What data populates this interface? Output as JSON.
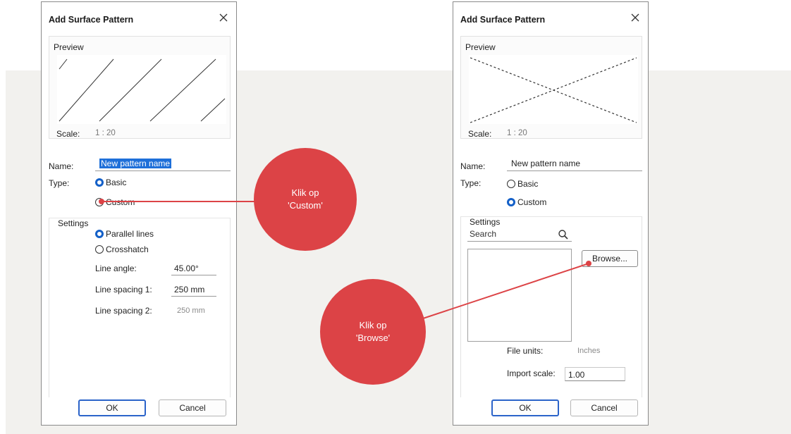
{
  "colors": {
    "accent": "#1460c8",
    "callout": "#dc4346",
    "background_band": "#f2f1ee"
  },
  "dialog_basic": {
    "title": "Add Surface Pattern",
    "close_icon": "close-icon",
    "preview_label": "Preview",
    "scale_label": "Scale:",
    "scale_value": "1 : 20",
    "name_label": "Name:",
    "name_value": "New pattern name",
    "type_label": "Type:",
    "type_options": [
      {
        "label": "Basic",
        "selected": true
      },
      {
        "label": "Custom",
        "selected": false
      }
    ],
    "settings_label": "Settings",
    "settings_options": [
      {
        "label": "Parallel lines",
        "selected": true
      },
      {
        "label": "Crosshatch",
        "selected": false
      }
    ],
    "line_angle_label": "Line angle:",
    "line_angle_value": "45.00°",
    "line_spacing1_label": "Line spacing 1:",
    "line_spacing1_value": "250 mm",
    "line_spacing2_label": "Line spacing 2:",
    "line_spacing2_value": "250 mm",
    "ok_label": "OK",
    "cancel_label": "Cancel"
  },
  "dialog_custom": {
    "title": "Add Surface Pattern",
    "close_icon": "close-icon",
    "preview_label": "Preview",
    "scale_label": "Scale:",
    "scale_value": "1 : 20",
    "name_label": "Name:",
    "name_value": "New pattern name",
    "type_label": "Type:",
    "type_options": [
      {
        "label": "Basic",
        "selected": false
      },
      {
        "label": "Custom",
        "selected": true
      }
    ],
    "settings_label": "Settings",
    "search_placeholder": "Search",
    "browse_label": "Browse...",
    "file_units_label": "File units:",
    "file_units_value": "Inches",
    "import_scale_label": "Import scale:",
    "import_scale_value": "1.00",
    "ok_label": "OK",
    "cancel_label": "Cancel"
  },
  "callouts": [
    {
      "line1": "Klik op",
      "line2": "'Custom'"
    },
    {
      "line1": "Klik op",
      "line2": "'Browse'"
    }
  ]
}
